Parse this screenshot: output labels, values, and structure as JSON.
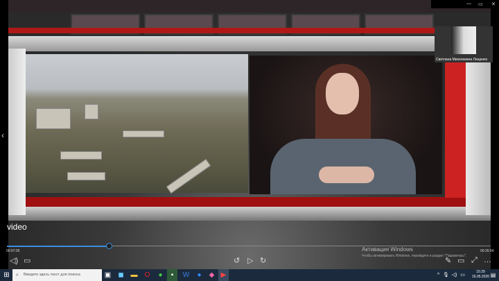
{
  "window": {
    "minimize": "—",
    "maximize": "▭",
    "close": "✕"
  },
  "participant": {
    "name": "Светлана Миколаевна Лещенко"
  },
  "video_label": "video",
  "player": {
    "elapsed": "00:07:05",
    "total": "00:26:54",
    "progress_percent": 21
  },
  "activation": {
    "title": "Активация Windows",
    "text": "Чтобы активировать Windows, перейдите в раздел \"Параметры\"."
  },
  "taskbar": {
    "search_placeholder": "Введите здесь текст для поиска",
    "time": "15:29",
    "date": "16.05.2020"
  }
}
